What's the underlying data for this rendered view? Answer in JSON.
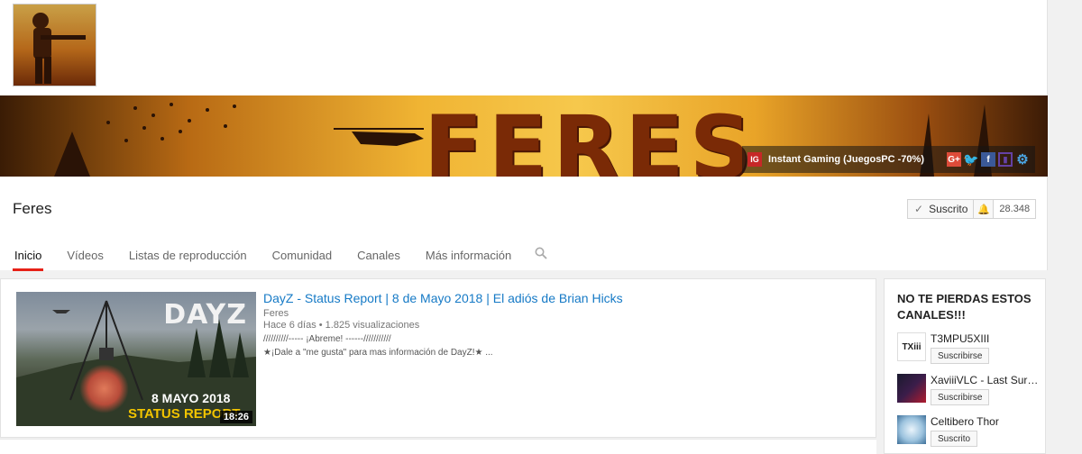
{
  "channel": {
    "name": "Feres",
    "banner_text": "FERES",
    "avatar_icon": "soldier-avatar",
    "subscribe_label": "Suscrito",
    "subscriber_count": "28.348"
  },
  "banner_links": {
    "ig_badge": "IG",
    "featured_link": "Instant Gaming (JuegosPC -70%)",
    "social": [
      {
        "name": "google-plus-icon",
        "glyph": "G+"
      },
      {
        "name": "twitter-icon",
        "glyph": "🐦"
      },
      {
        "name": "facebook-icon",
        "glyph": "f"
      },
      {
        "name": "twitch-icon",
        "glyph": "▮"
      },
      {
        "name": "settings-gear-icon",
        "glyph": "⚙"
      }
    ]
  },
  "tabs": [
    "Inicio",
    "Vídeos",
    "Listas de reproducción",
    "Comunidad",
    "Canales",
    "Más información"
  ],
  "active_tab": "Inicio",
  "accent_color": "#e62117",
  "link_color": "#167ac6",
  "featured_video": {
    "title": "DayZ - Status Report | 8 de Mayo 2018 | El adiós de Brian Hicks",
    "channel": "Feres",
    "meta": "Hace 6 días  •  1.825 visualizaciones",
    "description_line1": "//////////----- ¡Abreme! ------///////////",
    "description_line2": "★¡Dale a \"me gusta\" para mas información de DayZ!★ ...",
    "thumbnail": {
      "logo": "DAYZ",
      "date": "8 MAYO 2018",
      "caption": "STATUS REPORT",
      "duration": "18:26"
    }
  },
  "sidebar": {
    "title": "NO TE PIERDAS ESTOS CANALES!!!",
    "channels": [
      {
        "name": "T3MPU5XIII",
        "button": "Suscribirse",
        "avatar_text": "TXiii"
      },
      {
        "name": "XaviiiVLC - Last Survivors",
        "button": "Suscribirse",
        "avatar_text": ""
      },
      {
        "name": "Celtibero Thor",
        "button": "Suscrito",
        "avatar_text": ""
      }
    ]
  }
}
